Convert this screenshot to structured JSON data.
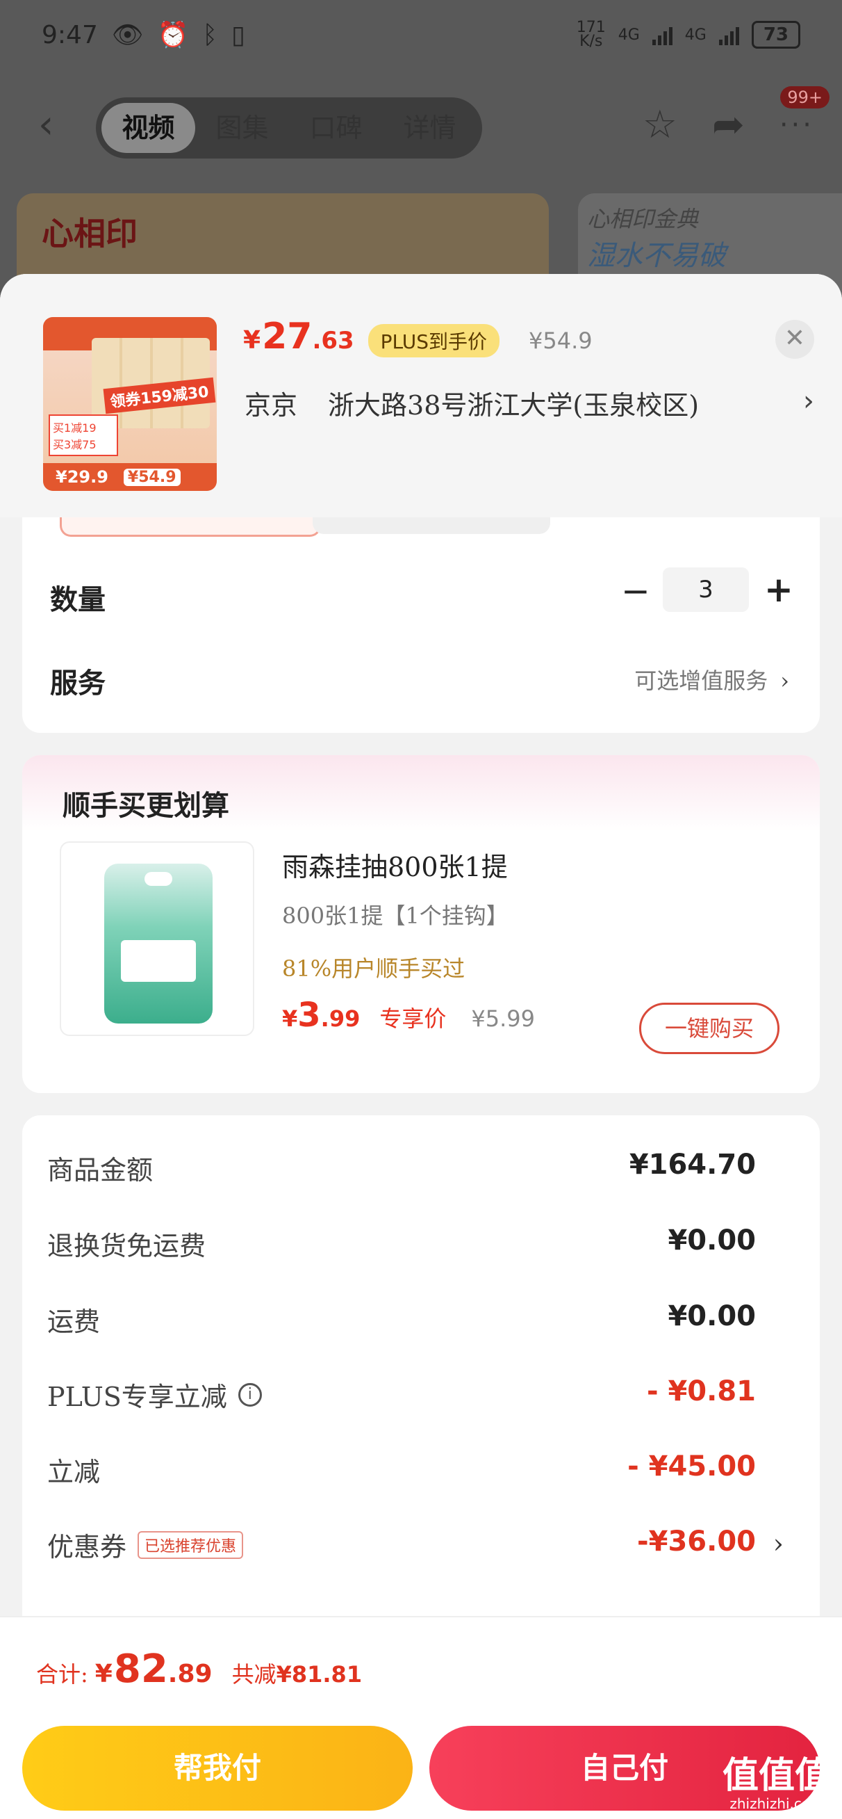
{
  "status": {
    "time": "9:47",
    "net_speed": "171\nK/s",
    "net1": "4G",
    "net2": "4G",
    "battery": "73"
  },
  "nav": {
    "tabs": [
      "视频",
      "图集",
      "口碑",
      "详情"
    ],
    "active_tab": 0,
    "badge": "99+"
  },
  "banner": {
    "brand": "心相印",
    "right_line1": "心相印金典",
    "right_line2": "湿水不易破"
  },
  "product": {
    "thumb_ribbon": "领券159减30",
    "thumb_promo1": "买1减19",
    "thumb_promo2": "买3减75",
    "thumb_price1": "¥29.9",
    "thumb_price2": "¥54.9",
    "price_currency": "¥",
    "price_int": "27",
    "price_dec": ".63",
    "plus_tag": "PLUS到手价",
    "original_price": "¥54.9",
    "address_prefix": "京京",
    "address": "浙大路38号浙江大学(玉泉校区)"
  },
  "quantity": {
    "label": "数量",
    "value": "3"
  },
  "service": {
    "label": "服务",
    "value": "可选增值服务"
  },
  "bundle": {
    "title": "顺手买更划算",
    "name": "雨森挂抽800张1提",
    "spec": "800张1提【1个挂钩】",
    "social": "81%用户顺手买过",
    "price_currency": "¥",
    "price_int": "3",
    "price_dec": ".99",
    "price_tag": "专享价",
    "original_price": "¥5.99",
    "buy_label": "一键购买"
  },
  "summary": {
    "rows": [
      {
        "label": "商品金额",
        "value": "¥164.70"
      },
      {
        "label": "退换货免运费",
        "value": "¥0.00"
      },
      {
        "label": "运费",
        "value": "¥0.00"
      },
      {
        "label": "PLUS专享立减",
        "value": "- ¥0.81"
      },
      {
        "label": "立减",
        "value": "- ¥45.00"
      },
      {
        "label": "优惠券",
        "value": "-¥36.00",
        "tag": "已选推荐优惠"
      }
    ]
  },
  "footer": {
    "total_label": "合计:",
    "total_currency": "¥",
    "total_int": "82",
    "total_dec": ".89",
    "saved_label": "共减",
    "saved_value": "¥81.81",
    "help_pay": "帮我付",
    "self_pay": "自己付"
  },
  "watermark": {
    "big": "值值值",
    "small": "zhizhizhi.com"
  },
  "colors": {
    "accent_red": "#e8321f",
    "plus_yellow": "#fae07a",
    "help_button": "#ffcc17",
    "self_button": "#e3233f"
  }
}
